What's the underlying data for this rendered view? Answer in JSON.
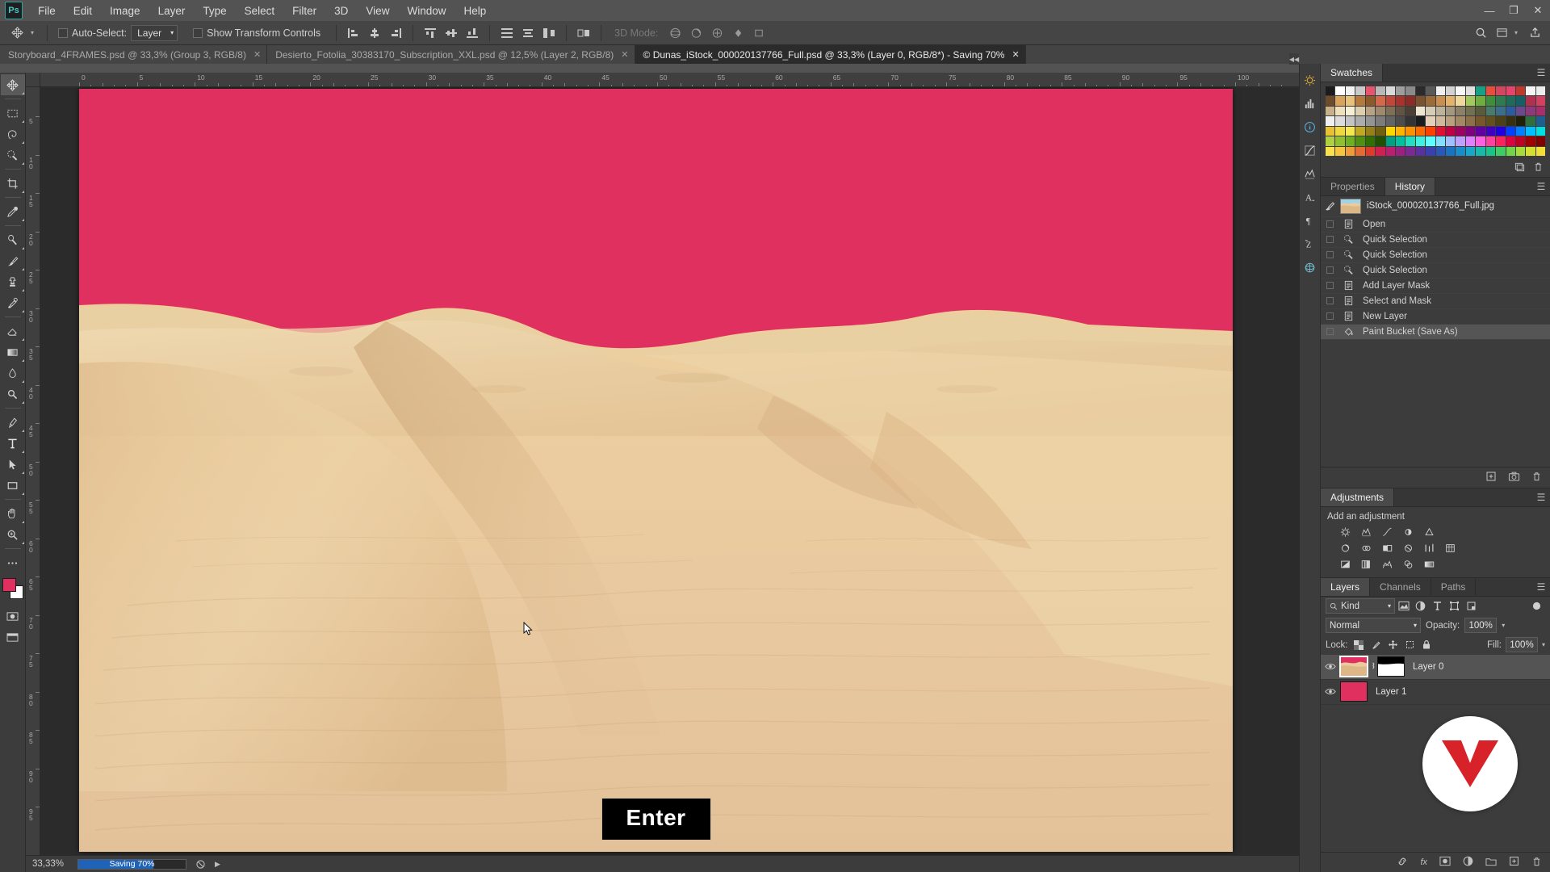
{
  "app": {
    "name": "Adobe Photoshop",
    "logo_text": "Ps"
  },
  "window_controls": {
    "minimize": "—",
    "maximize": "❐",
    "close": "✕"
  },
  "menubar": {
    "items": [
      {
        "label": "File"
      },
      {
        "label": "Edit"
      },
      {
        "label": "Image"
      },
      {
        "label": "Layer"
      },
      {
        "label": "Type"
      },
      {
        "label": "Select"
      },
      {
        "label": "Filter"
      },
      {
        "label": "3D"
      },
      {
        "label": "View"
      },
      {
        "label": "Window"
      },
      {
        "label": "Help"
      }
    ]
  },
  "options_bar": {
    "tool_icon": "move-tool-icon",
    "auto_select_label": "Auto-Select:",
    "auto_select_checked": false,
    "auto_select_value": "Layer",
    "show_transform_label": "Show Transform Controls",
    "show_transform_checked": false,
    "three_d_mode_label": "3D Mode:",
    "align_icons": [
      "align-left-edges-icon",
      "align-horizontal-centers-icon",
      "align-right-edges-icon"
    ],
    "align_icons2": [
      "align-top-edges-icon",
      "align-vertical-centers-icon",
      "align-bottom-edges-icon"
    ],
    "distribute_icons": [
      "distribute-top-icon",
      "distribute-vertical-center-icon",
      "distribute-bottom-icon"
    ],
    "extra_icons": [
      "auto-align-icon"
    ],
    "three_d_icons": [
      "3d-orbit-icon",
      "3d-roll-icon",
      "3d-pan-icon",
      "3d-slide-icon",
      "3d-scale-icon"
    ],
    "right_icons": [
      "search-icon",
      "workspace-icon",
      "share-icon"
    ]
  },
  "tabs": [
    {
      "label": "Storyboard_4FRAMES.psd @ 33,3% (Group 3, RGB/8)",
      "active": false,
      "close": "✕"
    },
    {
      "label": "Desierto_Fotolia_30383170_Subscription_XXL.psd @ 12,5% (Layer 2, RGB/8)",
      "active": false,
      "close": "✕"
    },
    {
      "label": "© Dunas_iStock_000020137766_Full.psd @ 33,3% (Layer 0, RGB/8*) - Saving 70%",
      "active": true,
      "close": "✕"
    }
  ],
  "toolbar": {
    "tools": [
      {
        "name": "move-tool-icon",
        "selected": true
      },
      {
        "name": "rectangular-marquee-tool-icon",
        "selected": false
      },
      {
        "name": "lasso-tool-icon",
        "selected": false
      },
      {
        "name": "quick-selection-tool-icon",
        "selected": false
      },
      {
        "name": "crop-tool-icon",
        "selected": false
      },
      {
        "name": "eyedropper-tool-icon",
        "selected": false
      },
      {
        "name": "spot-healing-brush-tool-icon",
        "selected": false
      },
      {
        "name": "brush-tool-icon",
        "selected": false
      },
      {
        "name": "clone-stamp-tool-icon",
        "selected": false
      },
      {
        "name": "history-brush-tool-icon",
        "selected": false
      },
      {
        "name": "eraser-tool-icon",
        "selected": false
      },
      {
        "name": "gradient-tool-icon",
        "selected": false
      },
      {
        "name": "blur-tool-icon",
        "selected": false
      },
      {
        "name": "dodge-tool-icon",
        "selected": false
      },
      {
        "name": "pen-tool-icon",
        "selected": false
      },
      {
        "name": "type-tool-icon",
        "selected": false
      },
      {
        "name": "path-selection-tool-icon",
        "selected": false
      },
      {
        "name": "rectangle-tool-icon",
        "selected": false
      },
      {
        "name": "hand-tool-icon",
        "selected": false
      },
      {
        "name": "zoom-tool-icon",
        "selected": false
      },
      {
        "name": "edit-toolbar-icon",
        "selected": false
      }
    ],
    "foreground_color": "#e0305f",
    "background_color": "#ffffff",
    "quick_mask_icon": "quick-mask-icon",
    "screen_mode_icon": "screen-mode-icon"
  },
  "rulers": {
    "unit": "cm",
    "horizontal_ticks": [
      "0",
      "5",
      "10",
      "15",
      "20",
      "25",
      "30",
      "35",
      "40",
      "45",
      "50",
      "55",
      "60",
      "65",
      "70",
      "75",
      "80",
      "85",
      "90",
      "95",
      "100"
    ],
    "vertical_ticks": [
      "5",
      "10",
      "15",
      "20",
      "25",
      "30",
      "35",
      "40",
      "45",
      "50",
      "55",
      "60",
      "65",
      "70",
      "75",
      "80",
      "85",
      "90",
      "95"
    ]
  },
  "canvas": {
    "sky_color": "#e0305f",
    "sand_color": "#e9cb9d",
    "overlay_button": "Enter",
    "cursor_icon": "mouse-pointer-icon"
  },
  "statusbar": {
    "zoom": "33,33%",
    "progress_label": "Saving 70%",
    "progress_percent": 70,
    "progress_color": "#1f63b8",
    "stop_icon": "stop-icon",
    "expand_icon": "expand-arrow-icon"
  },
  "icon_rail": {
    "buttons": [
      "brightness-contrast-icon",
      "histogram-icon",
      "info-icon",
      "curves-icon",
      "levels-icon",
      "character-panel-icon",
      "paragraph-panel-icon",
      "glyphs-panel-icon",
      "3d-panel-icon"
    ],
    "collapse_icon": "collapse-panels-icon"
  },
  "panels": {
    "swatches": {
      "tab_label": "Swatches",
      "menu_icon": "panel-menu-icon",
      "new_swatch_icon": "new-swatch-icon",
      "delete_swatch_icon": "trash-icon",
      "colors": [
        "#1c1c1c",
        "#ffffff",
        "#f2f2f2",
        "#c9c9c9",
        "#e8536d",
        "#b8b8b8",
        "#d9d9d9",
        "#9e9e9e",
        "#8a8a8a",
        "#2b2b2b",
        "#5a5a5a",
        "#efefef",
        "#d2d2d2",
        "#f7f7f7",
        "#e0e0e0",
        "#16a085",
        "#e74c3c",
        "#d64560",
        "#e8436a",
        "#c0392b",
        "#f5f5f5",
        "#ededed",
        "#6e4b2a",
        "#d8a45c",
        "#e8c27a",
        "#b5793c",
        "#8f5a2b",
        "#d4684a",
        "#c0473a",
        "#a8332c",
        "#8e2b26",
        "#7a5230",
        "#9b6b3a",
        "#c98f4e",
        "#e3b36c",
        "#f0d79a",
        "#a2c95a",
        "#6fae3e",
        "#3f8e3a",
        "#2f7a4f",
        "#1f6b5a",
        "#155f66",
        "#b03050",
        "#d34060",
        "#c9b089",
        "#efe0be",
        "#f6eed6",
        "#dccfae",
        "#b8a284",
        "#9d8a6e",
        "#7e6f57",
        "#615442",
        "#4a4034",
        "#efe6d2",
        "#d6ccb5",
        "#bdb29a",
        "#a49880",
        "#8b8068",
        "#727050",
        "#5a5a3c",
        "#4a7a6a",
        "#3c6e8a",
        "#2e5b9e",
        "#6a4a8c",
        "#8c3a7a",
        "#a8306a",
        "#f0f0f0",
        "#dcdcdc",
        "#c4c4c4",
        "#acacac",
        "#949494",
        "#7c7c7c",
        "#646464",
        "#4c4c4c",
        "#343434",
        "#1c1c1c",
        "#e4d0b8",
        "#cfb89c",
        "#b9a080",
        "#a38864",
        "#8d7048",
        "#77582c",
        "#615020",
        "#4b4018",
        "#353010",
        "#1f2008",
        "#2f6f3f",
        "#1f5f8f",
        "#e8c030",
        "#f0d840",
        "#f8e850",
        "#c0a820",
        "#988018",
        "#706010",
        "#ffd700",
        "#ffb400",
        "#ff9000",
        "#ff6a00",
        "#ff4000",
        "#e01030",
        "#c00040",
        "#a00060",
        "#800080",
        "#6000a0",
        "#4000c0",
        "#2000e0",
        "#0040ff",
        "#0080ff",
        "#00c0ff",
        "#00e0e0",
        "#b0d040",
        "#90c030",
        "#70b020",
        "#509010",
        "#307000",
        "#205000",
        "#00a080",
        "#00c0a0",
        "#20e0c0",
        "#40f0e0",
        "#60ffff",
        "#80e0ff",
        "#a0c0ff",
        "#c0a0ff",
        "#e080ff",
        "#ff60e0",
        "#ff40a0",
        "#ff2060",
        "#e00040",
        "#c00020",
        "#a00000",
        "#800000",
        "#fbe14a",
        "#f5c542",
        "#ee9b3a",
        "#e66b33",
        "#dd3c2c",
        "#d02050",
        "#b81f6e",
        "#9c2080",
        "#7a2a92",
        "#5a32a0",
        "#3a40ae",
        "#2a58b8",
        "#1a72c0",
        "#1a8cc8",
        "#1aa6c8",
        "#1ab8a8",
        "#1ac488",
        "#3ecc64",
        "#72d44a",
        "#a8dc3c",
        "#d6e034",
        "#f2e03a"
      ]
    },
    "properties": {
      "tab_label": "Properties"
    },
    "history": {
      "tab_label": "History",
      "menu_icon": "panel-menu-icon",
      "snapshot": {
        "label": "iStock_000020137766_Full.jpg",
        "icon": "history-brush-icon"
      },
      "items": [
        {
          "label": "Open",
          "icon": "document-icon",
          "selected": false
        },
        {
          "label": "Quick Selection",
          "icon": "quick-selection-icon",
          "selected": false
        },
        {
          "label": "Quick Selection",
          "icon": "quick-selection-icon",
          "selected": false
        },
        {
          "label": "Quick Selection",
          "icon": "quick-selection-icon",
          "selected": false
        },
        {
          "label": "Add Layer Mask",
          "icon": "document-icon",
          "selected": false
        },
        {
          "label": "Select and Mask",
          "icon": "document-icon",
          "selected": false
        },
        {
          "label": "New Layer",
          "icon": "document-icon",
          "selected": false
        },
        {
          "label": "Paint Bucket (Save As)",
          "icon": "paint-bucket-icon",
          "selected": true
        }
      ],
      "footer_icons": [
        "new-document-from-state-icon",
        "new-snapshot-icon",
        "trash-icon"
      ]
    },
    "adjustments": {
      "tab_label": "Adjustments",
      "menu_icon": "panel-menu-icon",
      "subtitle": "Add an adjustment",
      "rows": [
        [
          "brightness-contrast-icon",
          "levels-icon",
          "curves-icon",
          "exposure-icon",
          "vibrance-icon"
        ],
        [
          "hue-saturation-icon",
          "color-balance-icon",
          "black-white-icon",
          "photo-filter-icon",
          "channel-mixer-icon",
          "color-lookup-icon"
        ],
        [
          "invert-icon",
          "posterize-icon",
          "threshold-icon",
          "selective-color-icon",
          "gradient-map-icon"
        ]
      ]
    },
    "layers": {
      "tabs": [
        {
          "label": "Layers",
          "active": true
        },
        {
          "label": "Channels",
          "active": false
        },
        {
          "label": "Paths",
          "active": false
        }
      ],
      "menu_icon": "panel-menu-icon",
      "filter_label": "Kind",
      "filter_icons": [
        "filter-pixel-icon",
        "filter-adjustment-icon",
        "filter-type-icon",
        "filter-shape-icon",
        "filter-smart-object-icon"
      ],
      "filter_toggle_icon": "filter-power-icon",
      "blend_mode": "Normal",
      "opacity_label": "Opacity:",
      "opacity_value": "100%",
      "lock_label": "Lock:",
      "lock_icons": [
        "lock-transparent-pixels-icon",
        "lock-image-pixels-icon",
        "lock-position-icon",
        "lock-artboard-icon",
        "lock-all-icon"
      ],
      "fill_label": "Fill:",
      "fill_value": "100%",
      "rows": [
        {
          "name": "Layer 0",
          "visible": true,
          "selected": true,
          "has_mask": true,
          "thumb": "photo",
          "mask_icon": "link-icon"
        },
        {
          "name": "Layer 1",
          "visible": true,
          "selected": false,
          "has_mask": false,
          "thumb": "pink"
        }
      ],
      "footer_icons": [
        "link-layers-icon",
        "layer-style-icon",
        "add-layer-mask-icon",
        "new-adjustment-layer-icon",
        "new-group-icon",
        "new-layer-icon",
        "delete-layer-icon"
      ]
    }
  }
}
